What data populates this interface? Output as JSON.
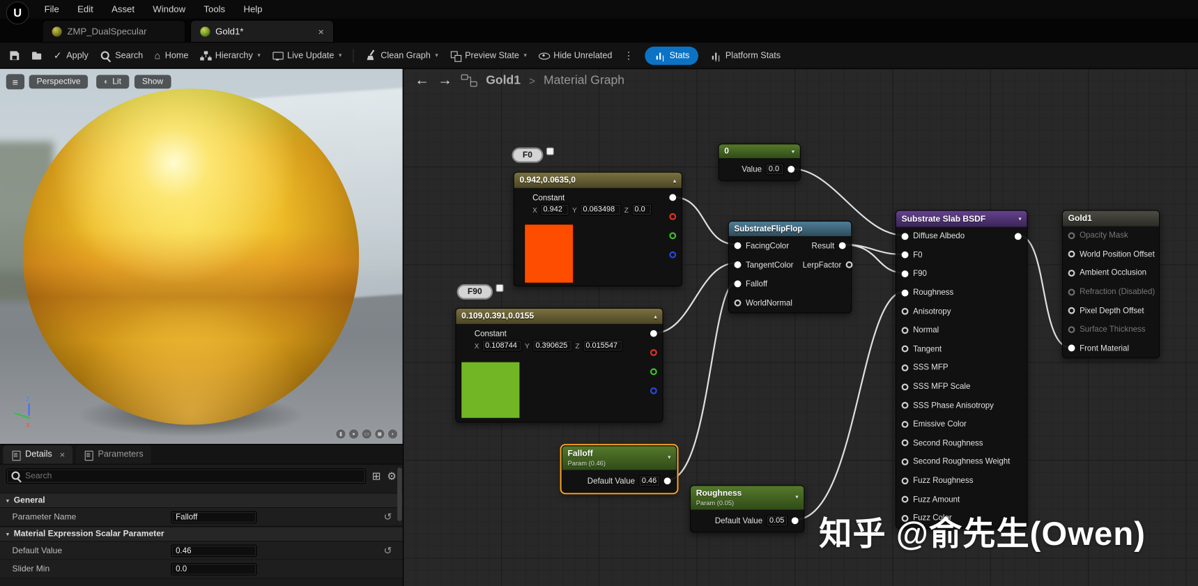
{
  "colors": {
    "accent_blue": "#0b72c4",
    "selection_orange": "#f7a022",
    "swatch_f0": "#ff4d00",
    "swatch_f90": "#72b626",
    "wire": "#e0e0e0",
    "header_constant": "#6b6133",
    "header_param": "#42611f",
    "header_flipflop": "#3f6a80",
    "header_bsdf": "#55357d"
  },
  "icons": {
    "close": "×",
    "caret": "▾",
    "back": "←",
    "forward": "→",
    "dots": "⋮",
    "hamburger": "≡",
    "house": "⌂",
    "check": "✓",
    "reset": "↺",
    "gear": "⚙",
    "grid": "⊞",
    "chevron_up": "▴",
    "chevron_down": "▾",
    "lit": "◐",
    "mesh_cylinder": "▮",
    "mesh_sphere": "●",
    "mesh_plane": "▭",
    "mesh_cube": "◼",
    "mesh_teapot": "◗",
    "logo": "U"
  },
  "menubar": {
    "items": [
      "File",
      "Edit",
      "Asset",
      "Window",
      "Tools",
      "Help"
    ]
  },
  "tabs": [
    {
      "label": "ZMP_DualSpecular"
    },
    {
      "label": "Gold1*"
    }
  ],
  "toolbar": {
    "apply": "Apply",
    "search": "Search",
    "home": "Home",
    "hierarchy": "Hierarchy",
    "live_update": "Live Update",
    "clean_graph": "Clean Graph",
    "preview_state": "Preview State",
    "hide_unrelated": "Hide Unrelated",
    "stats": "Stats",
    "platform_stats": "Platform Stats"
  },
  "viewport": {
    "perspective": "Perspective",
    "lit": "Lit",
    "show": "Show",
    "axis_z": "z",
    "axis_x": "x"
  },
  "details": {
    "tab_details": "Details",
    "tab_parameters": "Parameters",
    "search_placeholder": "Search",
    "general_title": "General",
    "parameter_name_label": "Parameter Name",
    "parameter_name_value": "Falloff",
    "scalar_section_title": "Material Expression Scalar Parameter",
    "default_value_label": "Default Value",
    "default_value": "0.46",
    "slider_min_label": "Slider Min",
    "slider_min": "0.0"
  },
  "breadcrumb": {
    "asset": "Gold1",
    "separator": ">",
    "page": "Material Graph"
  },
  "graph": {
    "axis": {
      "x": "X",
      "y": "Y",
      "z": "Z"
    },
    "nodes": {
      "f0_label": "F0",
      "f90_label": "F90",
      "const_f0": {
        "title": "0.942,0.0635,0",
        "type": "Constant",
        "x": "0.942",
        "y": "0.063498",
        "z": "0.0"
      },
      "const_f90": {
        "title": "0.109,0.391,0.0155",
        "type": "Constant",
        "x": "0.108744",
        "y": "0.390625",
        "z": "0.015547"
      },
      "scalar_zero": {
        "title": "0",
        "value_label": "Value",
        "value": "0.0"
      },
      "flipflop": {
        "title": "SubstrateFlipFlop",
        "inputs": [
          "FacingColor",
          "TangentColor",
          "Falloff",
          "WorldNormal"
        ],
        "outputs": [
          "Result",
          "LerpFactor"
        ]
      },
      "falloff": {
        "title": "Falloff",
        "subtitle": "Param (0.46)",
        "value_label": "Default Value",
        "value": "0.46"
      },
      "roughness": {
        "title": "Roughness",
        "subtitle": "Param (0.05)",
        "value_label": "Default Value",
        "value": "0.05"
      },
      "bsdf": {
        "title": "Substrate Slab BSDF",
        "inputs": [
          "Diffuse Albedo",
          "F0",
          "F90",
          "Roughness",
          "Anisotropy",
          "Normal",
          "Tangent",
          "SSS MFP",
          "SSS MFP Scale",
          "SSS Phase Anisotropy",
          "Emissive Color",
          "Second Roughness",
          "Second Roughness Weight",
          "Fuzz Roughness",
          "Fuzz Amount",
          "Fuzz Color"
        ]
      },
      "output": {
        "title": "Gold1",
        "pins": [
          "Opacity Mask",
          "World Position Offset",
          "Ambient Occlusion",
          "Refraction (Disabled)",
          "Pixel Depth Offset",
          "Surface Thickness",
          "Front Material"
        ]
      }
    },
    "watermark": "知乎 @俞先生(Owen)"
  }
}
